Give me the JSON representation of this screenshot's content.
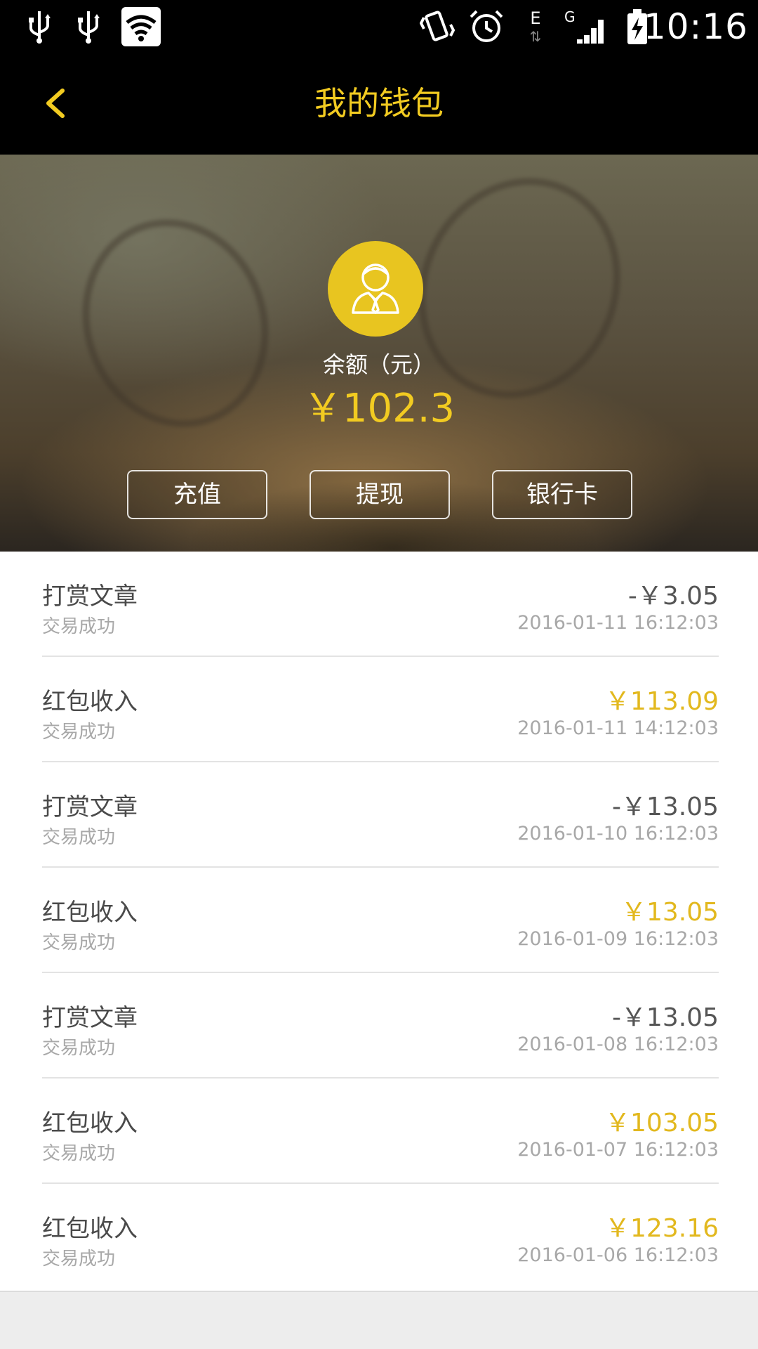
{
  "status_bar": {
    "time": "10:16",
    "icons": [
      "usb-icon",
      "usb-icon",
      "wifi-icon",
      "vibrate-icon",
      "alarm-icon",
      "network-e-icon",
      "signal-icon",
      "battery-charging-icon"
    ],
    "network_letter": "E",
    "signal_letter": "G"
  },
  "header": {
    "title": "我的钱包",
    "back_icon": "chevron-left-icon"
  },
  "wallet": {
    "avatar_icon": "user-avatar-icon",
    "balance_label": "余额（元）",
    "balance": "￥102.3",
    "buttons": [
      {
        "label": "充值"
      },
      {
        "label": "提现"
      },
      {
        "label": "银行卡"
      }
    ]
  },
  "transactions": [
    {
      "title": "打赏文章",
      "status": "交易成功",
      "amount": "-￥3.05",
      "type": "out",
      "date": "2016-01-11 16:12:03"
    },
    {
      "title": "红包收入",
      "status": "交易成功",
      "amount": "￥113.09",
      "type": "in",
      "date": "2016-01-11 14:12:03"
    },
    {
      "title": "打赏文章",
      "status": "交易成功",
      "amount": "-￥13.05",
      "type": "out",
      "date": "2016-01-10 16:12:03"
    },
    {
      "title": "红包收入",
      "status": "交易成功",
      "amount": "￥13.05",
      "type": "in",
      "date": "2016-01-09 16:12:03"
    },
    {
      "title": "打赏文章",
      "status": "交易成功",
      "amount": "-￥13.05",
      "type": "out",
      "date": "2016-01-08 16:12:03"
    },
    {
      "title": "红包收入",
      "status": "交易成功",
      "amount": "￥103.05",
      "type": "in",
      "date": "2016-01-07 16:12:03"
    },
    {
      "title": "红包收入",
      "status": "交易成功",
      "amount": "￥123.16",
      "type": "in",
      "date": "2016-01-06 16:12:03"
    }
  ],
  "colors": {
    "accent": "#f2cb21",
    "income": "#e2b81e",
    "expense": "#555555",
    "secondary_text": "#a8a8a8"
  }
}
